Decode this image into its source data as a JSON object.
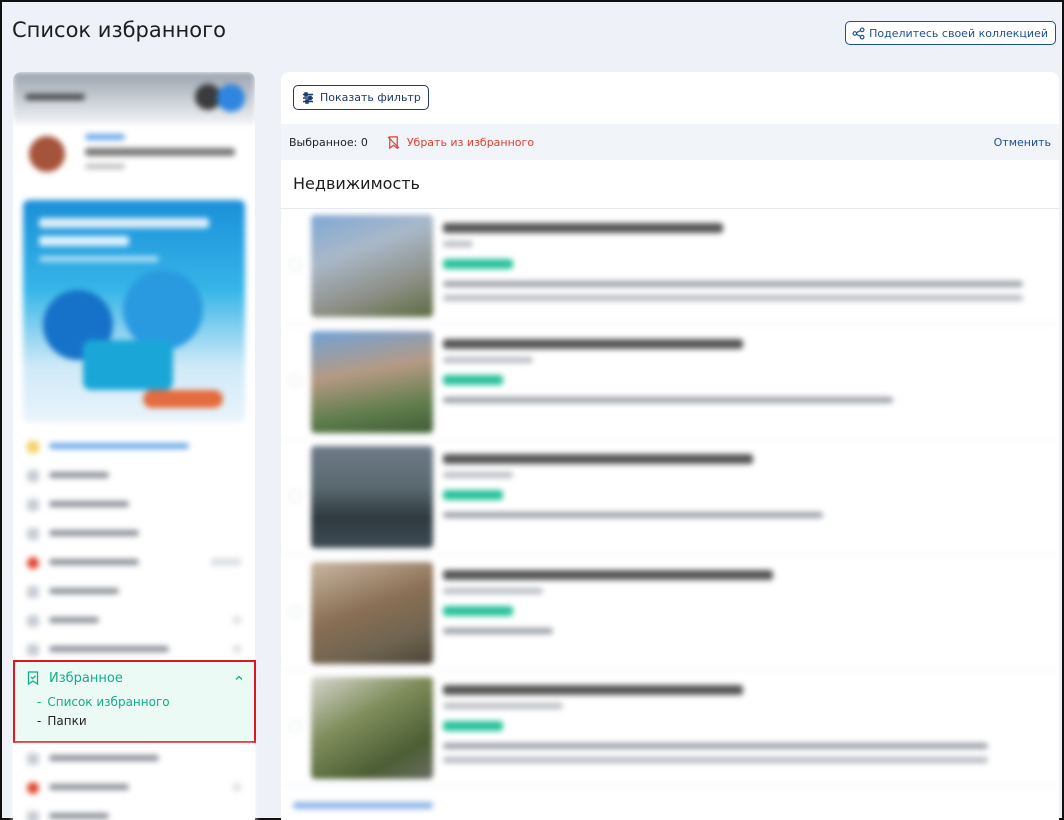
{
  "header": {
    "title": "Список избранного",
    "share_button": "Поделитесь своей коллекцией"
  },
  "sidebar": {
    "favorites": {
      "label": "Избранное",
      "items": [
        {
          "bullet": "-",
          "label": "Список избранного",
          "active": true
        },
        {
          "bullet": "-",
          "label": "Папки",
          "active": false
        }
      ]
    }
  },
  "main": {
    "filter_button": "Показать фильтр",
    "selection": {
      "count_label": "Выбранное: 0",
      "remove_label": "Убрать из избранного",
      "cancel_label": "Отменить"
    },
    "section_title": "Недвижимость"
  },
  "colors": {
    "accent": "#0fae8a",
    "primary": "#1f4f95",
    "danger": "#e1412e",
    "highlight_border": "#e0161e"
  }
}
